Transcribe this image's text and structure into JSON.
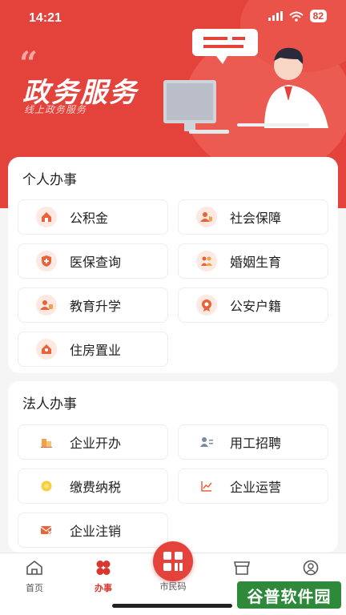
{
  "status": {
    "time": "14:21",
    "battery": "82"
  },
  "hero": {
    "quote_mark": "“",
    "title": "政务服务",
    "subtitle": "线上政务服务"
  },
  "personal": {
    "title": "个人办事",
    "items": [
      {
        "label": "公积金",
        "icon": "house-icon"
      },
      {
        "label": "社会保障",
        "icon": "people-shield-icon"
      },
      {
        "label": "医保查询",
        "icon": "medical-shield-icon"
      },
      {
        "label": "婚姻生育",
        "icon": "couple-icon"
      },
      {
        "label": "教育升学",
        "icon": "student-icon"
      },
      {
        "label": "公安户籍",
        "icon": "police-badge-icon"
      },
      {
        "label": "住房置业",
        "icon": "home-icon"
      }
    ]
  },
  "corporate": {
    "title": "法人办事",
    "items": [
      {
        "label": "企业开办",
        "icon": "building-icon"
      },
      {
        "label": "用工招聘",
        "icon": "recruit-icon"
      },
      {
        "label": "缴费纳税",
        "icon": "coin-icon"
      },
      {
        "label": "企业运营",
        "icon": "chart-icon"
      },
      {
        "label": "企业注销",
        "icon": "cancel-mail-icon"
      }
    ]
  },
  "tabbar": {
    "home": "首页",
    "work": "办事",
    "citizen_code": "市民码",
    "mine_icon": "user-icon"
  },
  "watermark": "谷普软件园",
  "colors": {
    "brand": "#e4433b",
    "icon_orange": "#e8623a"
  }
}
